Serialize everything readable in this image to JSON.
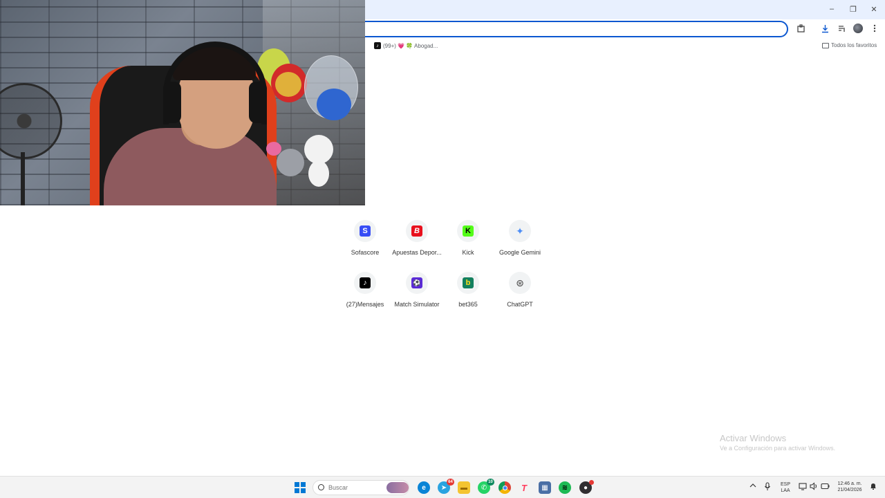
{
  "window": {
    "minimize": "–",
    "restore": "❐",
    "close": "✕"
  },
  "browser": {
    "toolbar_icons": [
      "extensions-icon",
      "download-icon",
      "reading-list-icon",
      "profile-avatar",
      "menu-icon"
    ],
    "bookmarks": {
      "item_label": "(99+) 💗 🍀 Abogad...",
      "all_favorites": "Todos los favoritos"
    }
  },
  "shortcuts": [
    {
      "label": "Sofascore",
      "glyph": "S",
      "bg": "#374df5"
    },
    {
      "label": "Apuestas Depor...",
      "glyph": "B",
      "bg": "#e8101d"
    },
    {
      "label": "Kick",
      "glyph": "K",
      "bg": "#53fc18"
    },
    {
      "label": "Google Gemini",
      "glyph": "✦",
      "bg": "#ffffff"
    },
    {
      "label": "(27)Mensajes",
      "glyph": "♪",
      "bg": "#000000"
    },
    {
      "label": "Match Simulator",
      "glyph": "⚽",
      "bg": "#5b2bd6"
    },
    {
      "label": "bet365",
      "glyph": "b",
      "bg": "#14805e"
    },
    {
      "label": "ChatGPT",
      "glyph": "⊛",
      "bg": "#ffffff"
    }
  ],
  "watermark": {
    "title": "Activar Windows",
    "subtitle": "Ve a Configuración para activar Windows."
  },
  "taskbar": {
    "search_placeholder": "Buscar",
    "apps": [
      {
        "name": "edge",
        "glyph": "e",
        "bg": "#0a84d6"
      },
      {
        "name": "telegram",
        "glyph": "➤",
        "bg": "#2aa3e0",
        "badge": "64"
      },
      {
        "name": "file-explorer",
        "glyph": "▬",
        "bg": "#f4c430"
      },
      {
        "name": "whatsapp",
        "glyph": "✆",
        "bg": "#25d366",
        "badge": "10"
      },
      {
        "name": "chrome",
        "glyph": "◉",
        "bg": "#db4437"
      },
      {
        "name": "tf-app",
        "glyph": "T",
        "bg": "#ff3b5c"
      },
      {
        "name": "calculator",
        "glyph": "▦",
        "bg": "#4a6fa5"
      },
      {
        "name": "spotify",
        "glyph": "≋",
        "bg": "#1db954"
      },
      {
        "name": "obs",
        "glyph": "●",
        "bg": "#302e31"
      }
    ],
    "lang_top": "ESP",
    "lang_bottom": "LAA",
    "time": "12:46 a. m.",
    "date": "21/04/2026"
  }
}
